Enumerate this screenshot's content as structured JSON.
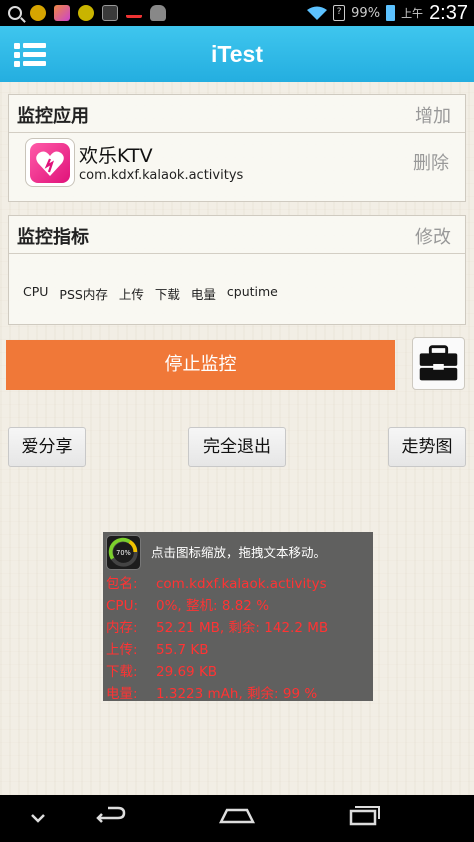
{
  "status_bar": {
    "battery_percent": "99%",
    "ampm": "上午",
    "time": "2:37",
    "icons": [
      "search-icon",
      "app-icon-1",
      "app-icon-2",
      "app-icon-3",
      "app-icon-4",
      "app-icon-5",
      "app-icon-6",
      "wifi-icon",
      "sim-icon",
      "battery-icon"
    ]
  },
  "app_bar": {
    "title": "iTest",
    "menu_icon": "menu-list-icon"
  },
  "monitor_app": {
    "header": "监控应用",
    "add_label": "增加",
    "app_name": "欢乐KTV",
    "package": "com.kdxf.kalaok.activitys",
    "delete_label": "删除",
    "icon": "heart-app-icon"
  },
  "monitor_metrics": {
    "header": "监控指标",
    "edit_label": "修改",
    "metrics": [
      "CPU",
      "PSS内存",
      "上传",
      "下载",
      "电量",
      "cputime"
    ]
  },
  "actions": {
    "stop_label": "停止监控",
    "toolbox_icon": "toolbox-icon",
    "share_label": "爱分享",
    "exit_label": "完全退出",
    "trend_label": "走势图"
  },
  "overlay": {
    "hint": "点击图标缩放，拖拽文本移动。",
    "lines": [
      {
        "label": "包名:",
        "value": "com.kdxf.kalaok.activitys"
      },
      {
        "label": "CPU:",
        "value": "0%,   整机:   8.82 %"
      },
      {
        "label": "内存:",
        "value": "52.21 MB,   剩余:   142.2 MB"
      },
      {
        "label": "上传:",
        "value": "55.7 KB"
      },
      {
        "label": "下载:",
        "value": "29.69 KB"
      },
      {
        "label": "电量:",
        "value": "1.3223 mAh,   剩余:   99 %"
      }
    ],
    "gauge_text": "70%",
    "text_color": "#ff3333"
  },
  "colors": {
    "app_bar": "#2bb5e6",
    "stop_button": "#f07838"
  },
  "nav_bar": {
    "icons": [
      "chevron-down-icon",
      "back-icon",
      "home-icon",
      "recent-apps-icon"
    ]
  }
}
